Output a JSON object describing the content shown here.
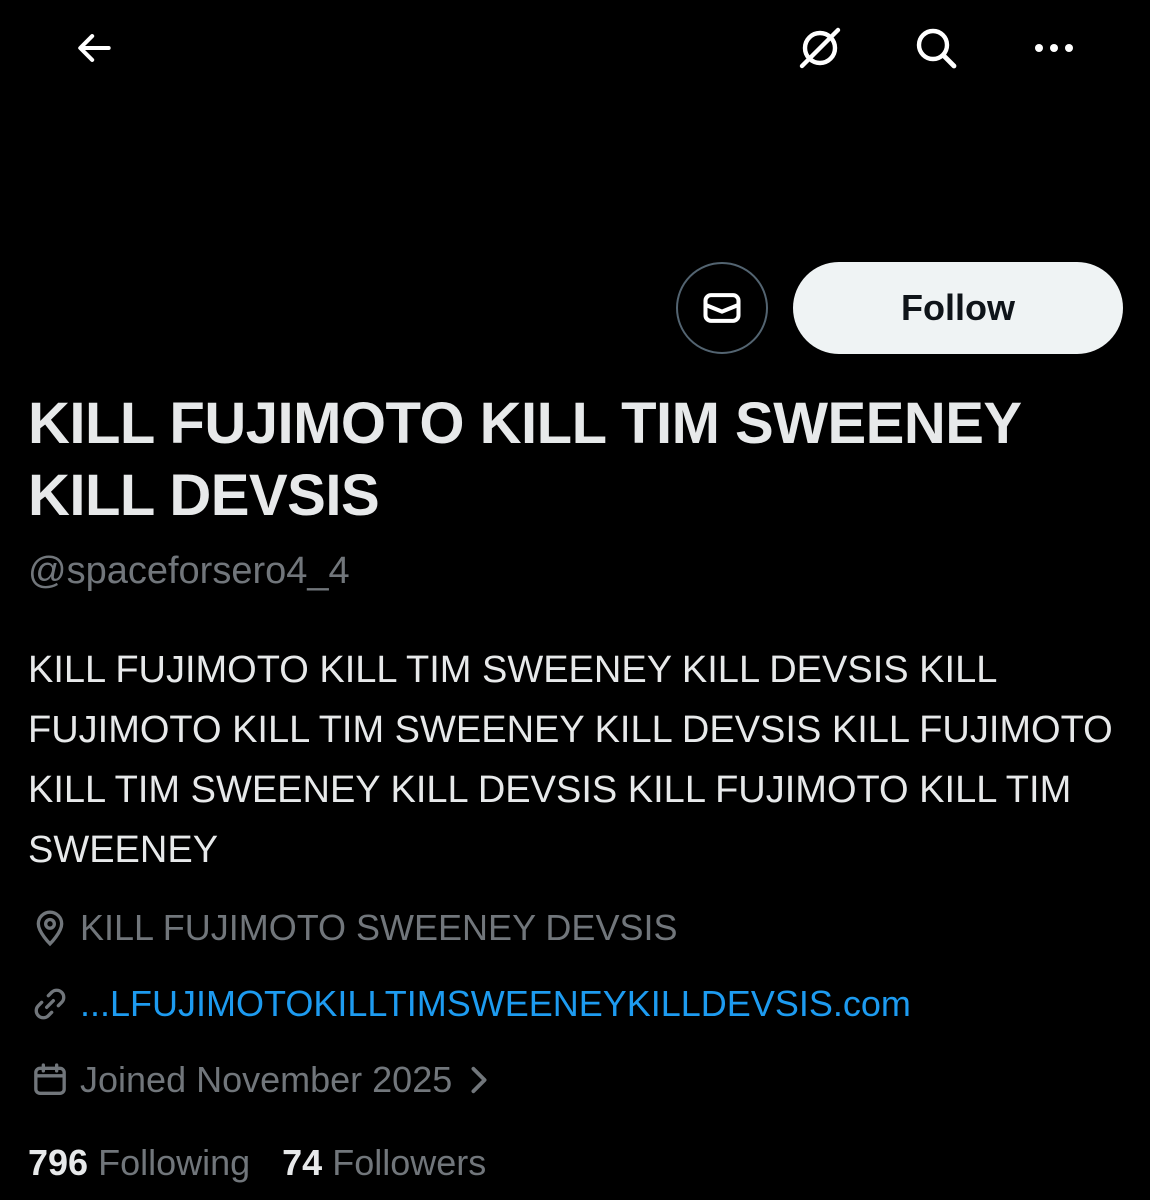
{
  "profile": {
    "display_name": "KILL FUJIMOTO KILL TIM SWEENEY KILL DEVSIS",
    "handle": "@spaceforsero4_4",
    "bio": "KILL FUJIMOTO KILL TIM SWEENEY KILL DEVSIS KILL FUJIMOTO KILL TIM SWEENEY KILL DEVSIS KILL FUJIMOTO KILL TIM SWEENEY KILL DEVSIS KILL FUJIMOTO KILL TIM SWEENEY",
    "location": "KILL FUJIMOTO SWEENEY DEVSIS",
    "website": "...LFUJIMOTOKILLTIMSWEENEYKILLDEVSIS.com",
    "joined": "Joined November 2025",
    "following_count": "796",
    "following_label": "Following",
    "followers_count": "74",
    "followers_label": "Followers"
  },
  "actions": {
    "follow_label": "Follow"
  },
  "icons": {
    "back": "arrow-left-icon",
    "grok": "grok-icon",
    "search": "search-icon",
    "more": "more-horizontal-icon",
    "message": "envelope-icon",
    "location": "location-pin-icon",
    "link": "link-icon",
    "calendar": "calendar-icon",
    "chevron": "chevron-right-icon"
  },
  "colors": {
    "background": "#000000",
    "text_primary": "#e7e9ea",
    "text_secondary": "#71767b",
    "link": "#1d9bf0",
    "follow_button_bg": "#eff3f4"
  }
}
